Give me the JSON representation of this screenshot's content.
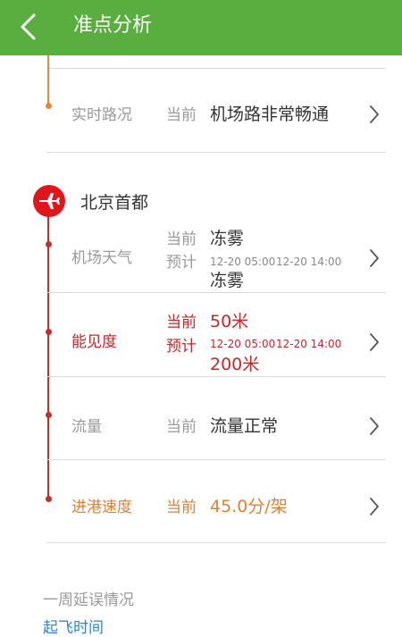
{
  "header": {
    "title": "准点分析",
    "back_icon": "chevron-left-icon",
    "bg_color": "#5aad3f"
  },
  "road": {
    "label": "实时路况",
    "current_label": "当前",
    "current_value": "机场路非常畅通"
  },
  "airport": {
    "name": "北京首都",
    "icon": "airplane-icon",
    "icon_color": "#e0161b"
  },
  "weather": {
    "label": "机场天气",
    "current_label": "当前",
    "current_value": "冻雾",
    "forecast_label": "预计",
    "forecast_time_from": "12-20 05:00",
    "forecast_time_to": "12-20 14:00",
    "forecast_value": "冻雾"
  },
  "visibility": {
    "label": "能见度",
    "current_label": "当前",
    "current_value": "50米",
    "forecast_label": "预计",
    "forecast_time_from": "12-20 05:00",
    "forecast_time_to": "12-20 14:00",
    "forecast_value": "200米",
    "color": "#c4262a"
  },
  "flow": {
    "label": "流量",
    "current_label": "当前",
    "current_value": "流量正常"
  },
  "arrival_speed": {
    "label": "进港速度",
    "current_label": "当前",
    "current_value": "45.0分/架",
    "color": "#e08038"
  },
  "weekly": {
    "title": "一周延误情况",
    "link": "起飞时间",
    "link_color": "#2b84d8"
  }
}
